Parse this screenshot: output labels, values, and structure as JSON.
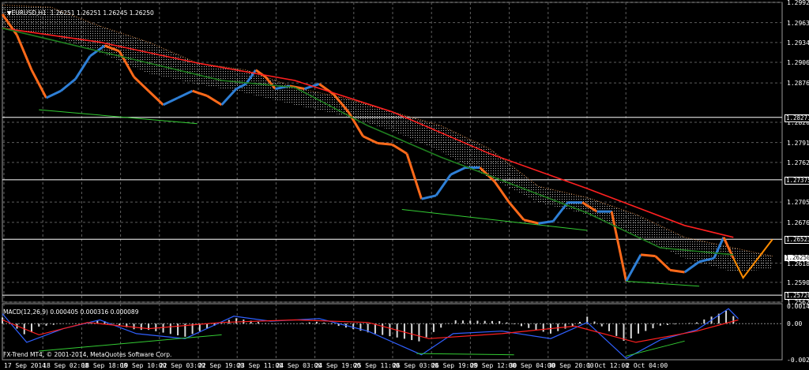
{
  "header": {
    "symbol_caption": "EURUSD,H1  1.26251 1.26251 1.26245 1.26250",
    "macd_caption": "MACD(12,26,9) 0.000405 0.000316 0.000089",
    "copyright": "FX-Trend MT4, © 2001-2014, MetaQuotes Software Corp."
  },
  "chart_data": {
    "type": "line",
    "symbol": "EURUSD",
    "timeframe": "H1",
    "ohlc": [
      1.26251,
      1.26251,
      1.26245,
      1.2625
    ],
    "price_axis": {
      "ticks": [
        "1.29920",
        "1.29630",
        "1.29345",
        "1.29060",
        "1.28765",
        "1.28200",
        "1.27910",
        "1.27625",
        "1.27055",
        "1.26765",
        "1.26180",
        "1.25905",
        "1.25620"
      ],
      "ylim": [
        1.2562,
        1.2992
      ]
    },
    "price_tags": [
      {
        "label": "1.28271",
        "value": 1.28271,
        "style": "line"
      },
      {
        "label": "1.27375",
        "value": 1.27375,
        "style": "line"
      },
      {
        "label": "1.26523",
        "value": 1.26523,
        "style": "line"
      },
      {
        "label": "1.26250",
        "value": 1.2625,
        "style": "current"
      },
      {
        "label": "1.25720",
        "value": 1.2572,
        "style": "line"
      }
    ],
    "macd_axis": {
      "ticks": [
        "0.0014",
        "0.00",
        "-0.002896"
      ],
      "ylim": [
        -0.0029,
        0.0016
      ]
    },
    "time_axis": [
      "17 Sep 2014",
      "18 Sep 02:00",
      "18 Sep 18:00",
      "19 Sep 10:00",
      "22 Sep 03:00",
      "22 Sep 19:00",
      "23 Sep 11:00",
      "24 Sep 03:00",
      "24 Sep 19:00",
      "25 Sep 11:00",
      "26 Sep 03:00",
      "26 Sep 19:00",
      "29 Sep 12:00",
      "30 Sep 04:00",
      "30 Sep 20:00",
      "1 Oct 12:00",
      "2 Oct 04:00"
    ],
    "close_series": [
      [
        0,
        1.2975
      ],
      [
        6,
        1.2945
      ],
      [
        12,
        1.2895
      ],
      [
        18,
        1.2855
      ],
      [
        24,
        1.2865
      ],
      [
        30,
        1.2882
      ],
      [
        36,
        1.2915
      ],
      [
        42,
        1.293
      ],
      [
        48,
        1.2922
      ],
      [
        54,
        1.2885
      ],
      [
        60,
        1.2865
      ],
      [
        66,
        1.2845
      ],
      [
        72,
        1.2855
      ],
      [
        78,
        1.2865
      ],
      [
        84,
        1.2858
      ],
      [
        90,
        1.2845
      ],
      [
        96,
        1.2868
      ],
      [
        100,
        1.2875
      ],
      [
        104,
        1.2895
      ],
      [
        108,
        1.2885
      ],
      [
        112,
        1.2868
      ],
      [
        118,
        1.2872
      ],
      [
        124,
        1.2868
      ],
      [
        130,
        1.2875
      ],
      [
        136,
        1.286
      ],
      [
        142,
        1.2835
      ],
      [
        148,
        1.28
      ],
      [
        154,
        1.279
      ],
      [
        160,
        1.2788
      ],
      [
        166,
        1.2775
      ],
      [
        172,
        1.271
      ],
      [
        178,
        1.2715
      ],
      [
        184,
        1.2745
      ],
      [
        190,
        1.2755
      ],
      [
        196,
        1.2755
      ],
      [
        202,
        1.2735
      ],
      [
        208,
        1.2705
      ],
      [
        214,
        1.268
      ],
      [
        220,
        1.2675
      ],
      [
        226,
        1.2678
      ],
      [
        232,
        1.2705
      ],
      [
        238,
        1.2705
      ],
      [
        244,
        1.2692
      ],
      [
        250,
        1.2692
      ],
      [
        256,
        1.2592
      ],
      [
        262,
        1.263
      ],
      [
        268,
        1.2628
      ],
      [
        274,
        1.2608
      ],
      [
        280,
        1.2605
      ],
      [
        286,
        1.262
      ],
      [
        292,
        1.2625
      ],
      [
        296,
        1.2655
      ],
      [
        300,
        1.2625
      ]
    ],
    "series": [
      {
        "color": "#ff2020",
        "values": [
          [
            0,
            1.2955
          ],
          [
            40,
            1.2935
          ],
          [
            80,
            1.2905
          ],
          [
            120,
            1.288
          ],
          [
            160,
            1.2835
          ],
          [
            200,
            1.2775
          ],
          [
            240,
            1.2725
          ],
          [
            280,
            1.2672
          ],
          [
            300,
            1.2655
          ]
        ]
      },
      {
        "color": "#1f7f1f",
        "values": [
          [
            0,
            1.2955
          ],
          [
            30,
            1.293
          ],
          [
            60,
            1.2905
          ],
          [
            90,
            1.288
          ],
          [
            120,
            1.287
          ],
          [
            150,
            1.2815
          ],
          [
            180,
            1.277
          ],
          [
            210,
            1.273
          ],
          [
            240,
            1.269
          ],
          [
            270,
            1.264
          ],
          [
            300,
            1.263
          ]
        ]
      },
      {
        "color": "#ff8c00",
        "values": [
          [
            300,
            1.2625
          ],
          [
            304,
            1.2597
          ],
          [
            316,
            1.2652
          ]
        ]
      }
    ],
    "cloud_upper": [
      [
        0,
        1.2988
      ],
      [
        20,
        1.2985
      ],
      [
        40,
        1.2958
      ],
      [
        60,
        1.2935
      ],
      [
        80,
        1.2905
      ],
      [
        100,
        1.2895
      ],
      [
        120,
        1.287
      ],
      [
        140,
        1.2855
      ],
      [
        160,
        1.2835
      ],
      [
        180,
        1.2815
      ],
      [
        200,
        1.2782
      ],
      [
        220,
        1.2728
      ],
      [
        240,
        1.2712
      ],
      [
        260,
        1.2688
      ],
      [
        280,
        1.2655
      ],
      [
        300,
        1.264
      ],
      [
        316,
        1.2628
      ]
    ],
    "cloud_lower": [
      [
        0,
        1.2955
      ],
      [
        20,
        1.2945
      ],
      [
        40,
        1.292
      ],
      [
        60,
        1.289
      ],
      [
        80,
        1.2875
      ],
      [
        100,
        1.2862
      ],
      [
        120,
        1.2845
      ],
      [
        140,
        1.283
      ],
      [
        160,
        1.2808
      ],
      [
        180,
        1.2778
      ],
      [
        200,
        1.274
      ],
      [
        220,
        1.2705
      ],
      [
        240,
        1.2688
      ],
      [
        260,
        1.2658
      ],
      [
        280,
        1.2625
      ],
      [
        300,
        1.2605
      ],
      [
        316,
        1.261
      ]
    ],
    "trend_lines": [
      {
        "color": "#33cc33",
        "values": [
          [
            15,
            1.2838
          ],
          [
            80,
            1.2818
          ]
        ]
      },
      {
        "color": "#33cc33",
        "values": [
          [
            164,
            1.2695
          ],
          [
            240,
            1.2665
          ]
        ]
      },
      {
        "color": "#33cc33",
        "values": [
          [
            256,
            1.2592
          ],
          [
            286,
            1.2585
          ]
        ]
      }
    ],
    "macd_series": [
      {
        "color": "#3060ff",
        "values": [
          [
            0,
            0.0008
          ],
          [
            10,
            -0.0015
          ],
          [
            25,
            -0.0004
          ],
          [
            40,
            0.0003
          ],
          [
            55,
            -0.0008
          ],
          [
            75,
            -0.0012
          ],
          [
            95,
            0.0006
          ],
          [
            110,
            0.0002
          ],
          [
            130,
            0.0004
          ],
          [
            150,
            -0.0006
          ],
          [
            172,
            -0.0025
          ],
          [
            185,
            -0.0008
          ],
          [
            205,
            -0.0006
          ],
          [
            225,
            -0.0012
          ],
          [
            240,
            0.0001
          ],
          [
            256,
            -0.0028
          ],
          [
            270,
            -0.0013
          ],
          [
            285,
            -0.0005
          ],
          [
            298,
            0.0012
          ],
          [
            302,
            0.0004
          ]
        ]
      },
      {
        "color": "#ff2020",
        "values": [
          [
            0,
            0.0003
          ],
          [
            15,
            -0.0009
          ],
          [
            35,
            0.0001
          ],
          [
            60,
            -0.0004
          ],
          [
            90,
            0.0001
          ],
          [
            120,
            0.0003
          ],
          [
            150,
            0.0001
          ],
          [
            175,
            -0.0012
          ],
          [
            205,
            -0.0008
          ],
          [
            235,
            -0.0002
          ],
          [
            260,
            -0.0015
          ],
          [
            285,
            -0.0006
          ],
          [
            302,
            0.0003
          ]
        ]
      }
    ],
    "macd_trend_lines": [
      {
        "color": "#33cc33",
        "values": [
          [
            15,
            -0.0022
          ],
          [
            90,
            -0.0009
          ]
        ]
      },
      {
        "color": "#33cc33",
        "values": [
          [
            170,
            -0.0024
          ],
          [
            210,
            -0.0025
          ]
        ]
      },
      {
        "color": "#33cc33",
        "values": [
          [
            256,
            -0.0026
          ],
          [
            280,
            -0.0014
          ]
        ]
      }
    ],
    "grid": true
  }
}
